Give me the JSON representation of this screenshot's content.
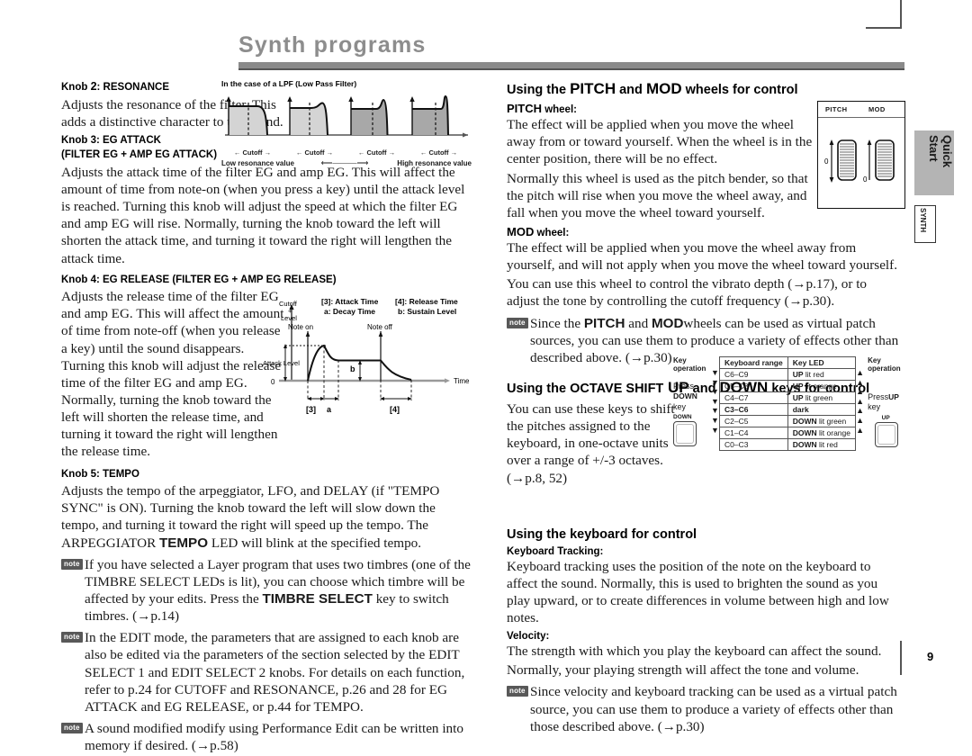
{
  "page": {
    "title": "Synth programs",
    "number": "9",
    "side_tabs": [
      {
        "label": "Quick Start",
        "style": "filled"
      },
      {
        "label": "SYNTH",
        "style": "outline"
      }
    ]
  },
  "left_column": {
    "knob2": {
      "heading_prefix": "Knob ",
      "heading_num": "2",
      "heading_rest": ": RESONANCE",
      "body": "Adjusts the resonance of the filter. This adds a distinctive character to the sound."
    },
    "knob3": {
      "heading": "Knob 3: EG ATTACK",
      "heading2": "(FILTER EG + AMP EG ATTACK)",
      "body": "Adjusts the attack time of the filter EG and amp EG. This will affect the amount of time from note-on (when you press a key) until the attack level is reached. Turning this knob will adjust the speed at which the filter EG and amp EG will rise. Normally, turning the knob toward the left will shorten the attack time, and turning it toward the right will lengthen the attack time."
    },
    "knob4": {
      "heading": "Knob 4: EG RELEASE (FILTER EG + AMP EG RELEASE)",
      "body": "Adjusts the release time of the filter EG and amp EG. This will affect the amount of time from note-off (when you release a key) until the sound disappears. Turning this knob will adjust the release time of the filter EG and amp EG. Normally, turning the knob toward the left will shorten the release time, and turning it toward the right will lengthen the release time."
    },
    "knob5": {
      "heading": "Knob 5: TEMPO",
      "body_a": "Adjusts the tempo of the arpeggiator, LFO, and DELAY (if \"TEMPO SYNC\" is ON). Turning the knob toward the left will slow down the tempo, and turning it toward the right will speed up the tempo. The ARPEGGIATOR ",
      "body_bold": "TEMPO",
      "body_b": " LED will blink at the specified tempo."
    },
    "notes": [
      {
        "badge": "note",
        "text_a": "If you have selected a Layer program that uses two timbres (one of the TIMBRE SELECT LEDs is lit), you can choose which timbre will be affected by your edits. Press the ",
        "text_bold": "TIMBRE SELECT",
        "text_b": "   key to switch timbres. (→p.14)"
      },
      {
        "badge": "note",
        "text_a": "In the EDIT mode, the parameters that are assigned to each knob are also be edited via the parameters of the section selected by the EDIT SELECT 1 and EDIT SELECT 2 knobs. For details on each function, refer to p.24 for CUTOFF and RESONANCE, p.26 and 28 for EG ATTACK and EG RELEASE, or p.44 for TEMPO.",
        "text_bold": "",
        "text_b": ""
      },
      {
        "badge": "note",
        "text_a": "A sound modified modify using Performance Edit can be written into memory if desired. (→p.58)",
        "text_bold": "",
        "text_b": ""
      }
    ]
  },
  "figures": {
    "lpf": {
      "caption": "In the case of a LPF (Low Pass Filter)",
      "cutoff_labels": [
        "Cutoff",
        "Cutoff",
        "Cutoff",
        "Cutoff"
      ],
      "left_label": "Low resonance value",
      "right_label": "High resonance value"
    },
    "eg": {
      "y_label_line1": "Cutoff",
      "y_label_line2": "+",
      "y_label_line3": "Level",
      "attack_level_label": "Attack Level",
      "zero_label": "0",
      "note_on_label": "Note on",
      "note_off_label": "Note off",
      "time_label": "Time",
      "legend_1": "[3]: Attack Time",
      "legend_2": "a: Decay Time",
      "legend_3": "[4]: Release Time",
      "legend_4": "b: Sustain Level",
      "mark_b": "b",
      "mark_3": "[3]",
      "mark_a": "a",
      "mark_4": "[4]"
    },
    "wheel": {
      "pitch_label": "PITCH",
      "mod_label": "MOD",
      "pitch_zero": "0",
      "mod_zero": "0"
    },
    "octave": {
      "left_head": "Key operation",
      "right_head": "Key operation",
      "left_press_a": "Press",
      "left_press_bold": "DOWN",
      "left_press_b": " key",
      "left_keycap_label": "DOWN",
      "right_press_a": "Press",
      "right_press_bold": "UP",
      "right_press_b": " key",
      "right_keycap_label": "UP",
      "columns": [
        "Keyboard range",
        "Key LED"
      ],
      "rows": [
        {
          "range": "C6–C9",
          "led_bold": "UP",
          "led_rest": " lit red",
          "dark": false
        },
        {
          "range": "C5–C8",
          "led_bold": "UP",
          "led_rest": " lit orange",
          "dark": false
        },
        {
          "range": "C4–C7",
          "led_bold": "UP",
          "led_rest": " lit green",
          "dark": false
        },
        {
          "range": "C3–C6",
          "led_bold": "",
          "led_rest": "dark",
          "dark": true
        },
        {
          "range": "C2–C5",
          "led_bold": "DOWN",
          "led_rest": " lit green",
          "dark": false
        },
        {
          "range": "C1–C4",
          "led_bold": "DOWN",
          "led_rest": " lit orange",
          "dark": false
        },
        {
          "range": "C0–C3",
          "led_bold": "DOWN",
          "led_rest": " lit red",
          "dark": false
        }
      ]
    }
  },
  "right_column": {
    "section_wheels": {
      "head_a": "Using the ",
      "head_b": "PITCH",
      "head_c": " and ",
      "head_d": "MOD",
      "head_e": " wheels for control"
    },
    "pitch": {
      "sub_bold": "PITCH",
      "sub_rest": " wheel:",
      "body_1": "The effect will be applied when you move the wheel away from or toward yourself. When the wheel is in the center position, there will be no effect.",
      "body_2": "Normally this wheel is used as the pitch bender, so that the pitch will rise when you move the wheel away, and fall when you move the wheel toward yourself."
    },
    "mod": {
      "sub_bold": "MOD",
      "sub_rest": " wheel:",
      "body_1": "The effect will be applied when you move the wheel away from yourself, and will not apply when you move the wheel toward yourself.",
      "body_2": "You can use this wheel to control the vibrato depth (→p.17), or to adjust the tone by controlling the cutoff frequency (→p.30)."
    },
    "note_wheels": {
      "badge": "note",
      "text_a": "Since the ",
      "bold_1": "PITCH",
      "text_b": "   and ",
      "bold_2": "MOD",
      "text_c": "wheels can be used as virtual patch sources, you can use them to produce a variety of effects other than described above. (→p.30)"
    },
    "section_octave": {
      "head_a": "Using the ",
      "head_b": "OCTAVE SHIFT",
      "head_c": " UP",
      "head_d": " and ",
      "head_e": "DOWN",
      "head_f": " keys for control",
      "body": "You can use these keys to shift the pitches assigned to the keyboard, in one-octave units over a range of +/-3 octaves. (→p.8, 52)"
    },
    "section_keyboard": {
      "head": "Using the keyboard for control",
      "tracking_head": "Keyboard Tracking:",
      "tracking_body": "Keyboard tracking uses the position of the note on the keyboard to affect the sound. Normally, this is used to brighten the sound as you play upward, or to create differences in volume between high and low notes.",
      "velocity_head": "Velocity:",
      "velocity_body_1": "The strength with which you play the keyboard can affect the sound.",
      "velocity_body_2": "Normally, your playing strength will affect the tone and volume."
    },
    "note_keyboard": {
      "badge": "note",
      "text": "Since velocity and keyboard tracking can be used as a virtual patch source, you can use them to produce a variety of effects other than those described above. (→p.30)"
    }
  }
}
